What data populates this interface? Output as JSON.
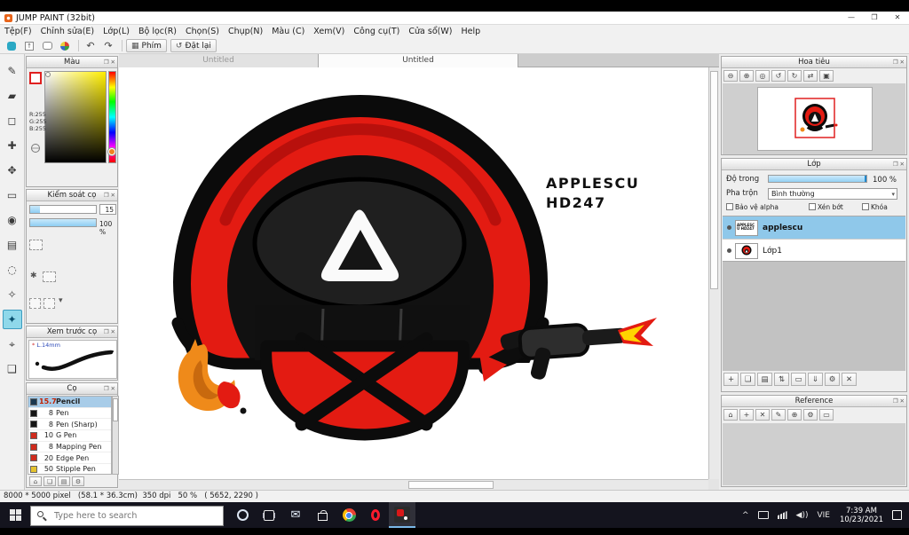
{
  "window": {
    "title": "JUMP PAINT (32bit)"
  },
  "menus": [
    "Tệp(F)",
    "Chỉnh sửa(E)",
    "Lớp(L)",
    "Bộ lọc(R)",
    "Chọn(S)",
    "Chụp(N)",
    "Màu (C)",
    "Xem(V)",
    "Công cụ(T)",
    "Cửa sổ(W)",
    "Help"
  ],
  "toolbar": {
    "phim": "Phím",
    "dat_lai": "Đặt lại"
  },
  "tabs": [
    "Untitled",
    "Untitled"
  ],
  "left": {
    "color": {
      "title": "Màu",
      "r": "R:255",
      "g": "G:255",
      "b": "B:255"
    },
    "brush_control": {
      "title": "Kiểm soát cọ",
      "size": "15",
      "opacity": "100 %"
    },
    "preview": {
      "title": "Xem trước cọ",
      "label": "L.14mm"
    },
    "brushes": {
      "title": "Cọ",
      "items": [
        {
          "size": "15.7",
          "name": "Pencil",
          "chip": "#1a3850"
        },
        {
          "size": "8",
          "name": "Pen",
          "chip": "#151515"
        },
        {
          "size": "8",
          "name": "Pen (Sharp)",
          "chip": "#151515"
        },
        {
          "size": "10",
          "name": "G Pen",
          "chip": "#cf2b1d"
        },
        {
          "size": "8",
          "name": "Mapping Pen",
          "chip": "#cf2b1d"
        },
        {
          "size": "20",
          "name": "Edge Pen",
          "chip": "#cf2b1d"
        },
        {
          "size": "50",
          "name": "Stipple Pen",
          "chip": "#e4c22f"
        }
      ]
    }
  },
  "right": {
    "navigator": {
      "title": "Hoa tiêu"
    },
    "layers": {
      "title": "Lớp",
      "opacity_label": "Độ trong",
      "opacity_value": "100 %",
      "blend_label": "Pha trộn",
      "blend_value": "Bình thường",
      "cb_alpha": "Bảo vệ alpha",
      "cb_clip": "Xén bớt",
      "cb_lock": "Khóa",
      "items": [
        {
          "name": "applescu",
          "thumb_text": "APPLESCU HD247"
        },
        {
          "name": "Lớp1"
        }
      ]
    },
    "reference": {
      "title": "Reference"
    }
  },
  "canvas": {
    "watermark1": "APPLESCU",
    "watermark2": "HD247"
  },
  "status": {
    "text": "8000 * 5000 pixel   (58.1 * 36.3cm)  350 dpi   50 %   ( 5652, 2290 )"
  },
  "taskbar": {
    "search": "Type here to search",
    "lang": "VIE",
    "time": "7:39 AM",
    "date": "10/23/2021"
  },
  "icons": {
    "min": "—",
    "max": "❐",
    "close": "✕",
    "dock": "❐",
    "caret": "▾",
    "undo": "↶",
    "redo": "↷",
    "reset": "↺",
    "grid": "▦",
    "pen": "✎",
    "eraser": "▰",
    "marquee": "◻",
    "brush": "✚",
    "move": "✥",
    "shape": "▭",
    "fill": "◉",
    "gradient": "▤",
    "lasso": "◌",
    "magnet": "✧",
    "wand": "✦",
    "crosshair": "⌖",
    "hand": "❑",
    "zoom_out": "⊖",
    "zoom_in": "⊕",
    "zoom_fit": "◎",
    "rotate_left": "↺",
    "rotate_right": "↻",
    "flip": "⇄",
    "actual": "▣",
    "home": "⌂",
    "plus": "+",
    "dup": "❏",
    "folder": "▤",
    "updown": "⇅",
    "merge": "⇓",
    "gear": "⚙",
    "trash": "✕",
    "page": "❏",
    "down": "▾",
    "star": "✱"
  },
  "colors": {
    "red": "#e31b12",
    "orange": "#ef8a1a",
    "yellow": "#ffd400",
    "accent": "#3ca6e0"
  }
}
